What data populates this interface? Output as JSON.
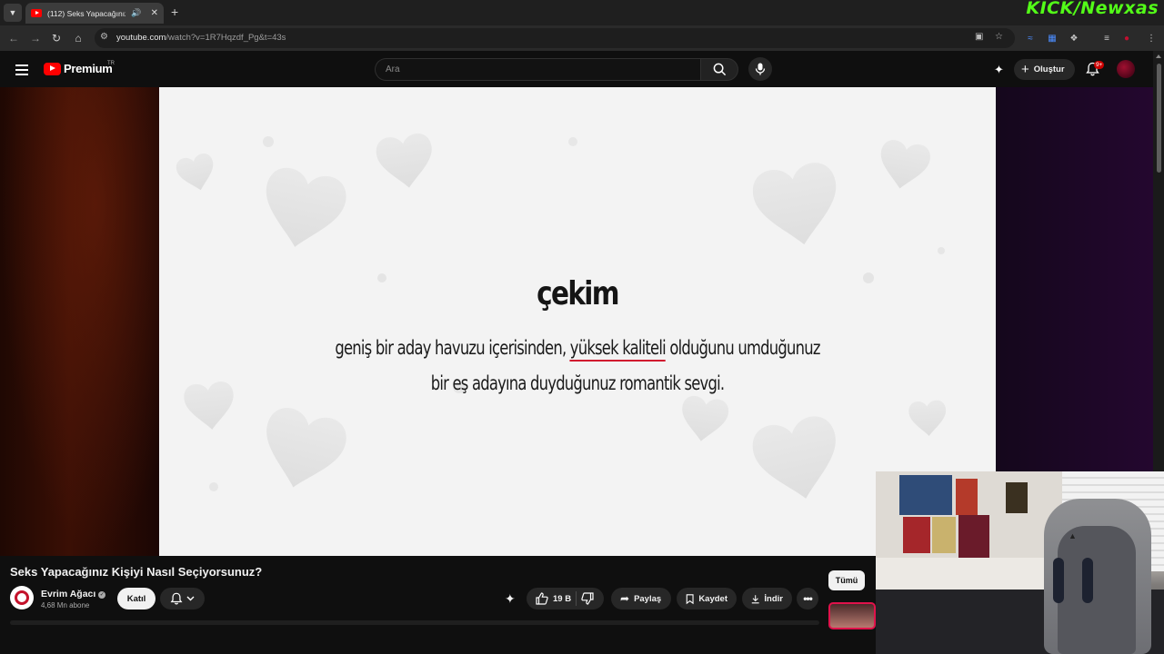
{
  "browser": {
    "tab_title": "(112) Seks Yapacağınız Kişiyi Nasıl Seçiyorsunuz? - YouTube",
    "url_host": "youtube.com",
    "url_path": "/watch?v=1R7Hqzdf_Pg&t=43s",
    "overlay_watermark": "KICK/Newxas"
  },
  "header": {
    "logo_text": "Premium",
    "region": "TR",
    "search_placeholder": "Ara",
    "create_label": "Oluştur",
    "notification_badge": "9+"
  },
  "video": {
    "term": "çekim",
    "definition_pre": "geniş bir aday havuzu içerisinden, ",
    "definition_highlight": "yüksek kaliteli",
    "definition_post": " olduğunu umduğunuz",
    "definition_line2": "bir eş adayına duyduğunuz romantik sevgi."
  },
  "meta": {
    "title": "Seks Yapacağınız Kişiyi Nasıl Seçiyorsunuz?",
    "channel_name": "Evrim Ağacı",
    "subscribers": "4,68 Mn abone",
    "join_label": "Katıl",
    "likes": "19 B",
    "share_label": "Paylaş",
    "save_label": "Kaydet",
    "download_label": "İndir"
  },
  "recommendations": {
    "chip_all": "Tümü"
  },
  "colors": {
    "accent_red": "#ff0000",
    "highlight_underline": "#d1192f",
    "kick_green": "#53fc18"
  }
}
